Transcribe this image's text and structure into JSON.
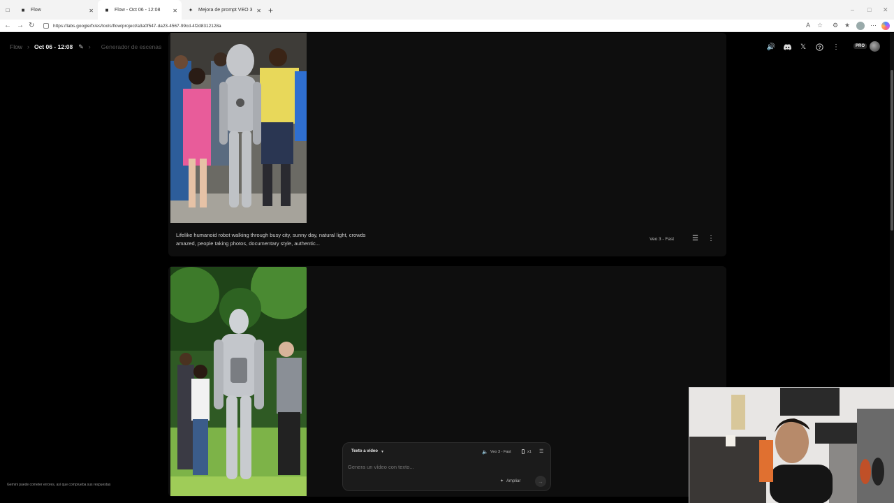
{
  "browser": {
    "tabs": [
      {
        "title": "Flow"
      },
      {
        "title": "Flow - Oct 06 - 12:08"
      },
      {
        "title": "Mejora de prompt VEO 3"
      }
    ],
    "url": "https://labs.google/fx/es/tools/flow/project/a3a0f547-da23-4567-99cd-4f2d8312128a"
  },
  "header": {
    "app_name": "Flow",
    "project_title": "Oct 06 - 12:08",
    "scene_label": "Generador de escenas",
    "plan_badge": "PRO"
  },
  "cards": [
    {
      "prompt": "Lifelike humanoid robot walking through busy city, sunny day, natural light, crowds amazed, people taking photos, documentary style, authentic...",
      "model": "Veo 3 - Fast"
    }
  ],
  "composer": {
    "mode": "Texto a vídeo",
    "model": "Veo 3 - Fast",
    "count": "x1",
    "placeholder": "Genera un vídeo con texto...",
    "expand_label": "Ampliar"
  },
  "footer": {
    "disclaimer": "Gemini puede cometer errores, así que comprueba sus respuestas"
  },
  "colors": {
    "background": "#000000",
    "card": "#0e0e0e",
    "composer": "#1b1b1b"
  }
}
